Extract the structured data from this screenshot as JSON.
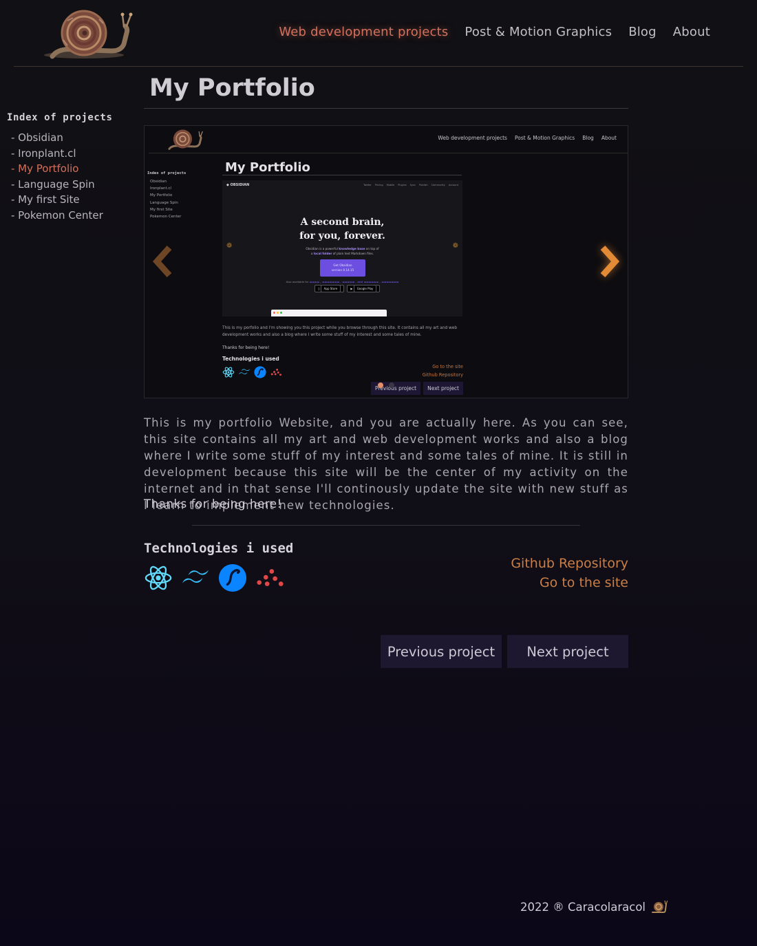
{
  "header": {
    "logo_icon": "snail-logo-icon",
    "nav": [
      {
        "label": "Web development projects",
        "active": true
      },
      {
        "label": "Post & Motion Graphics",
        "active": false
      },
      {
        "label": "Blog",
        "active": false
      },
      {
        "label": "About",
        "active": false
      }
    ]
  },
  "sidebar": {
    "title": "Index of projects",
    "items": [
      {
        "label": "- Obsidian"
      },
      {
        "label": "- Ironplant.cl"
      },
      {
        "label": "- My Portfolio",
        "active": true
      },
      {
        "label": "- Language Spin"
      },
      {
        "label": "- My first Site"
      },
      {
        "label": "- Pokemon Center"
      }
    ]
  },
  "main": {
    "title": "My Portfolio",
    "carousel": {
      "prev_icon": "chevron-left-icon",
      "next_icon": "chevron-right-icon",
      "slide_count": 2,
      "active_slide": 1,
      "preview": {
        "nav": [
          "Web development projects",
          "Post & Motion Graphics",
          "Blog",
          "About"
        ],
        "title": "My Portfolio",
        "sidebar_title": "Index of projects",
        "sidebar_items": [
          "Obsidian",
          "Ironplant.cl",
          "My Portfolio",
          "Language Spin",
          "My first Site",
          "Pokemon Center"
        ],
        "obsidian": {
          "brand": "OBSIDIAN",
          "links": [
            "Twitter",
            "Pricing",
            "Mobile",
            "Plugins",
            "Sync",
            "Publish",
            "Community",
            "Account"
          ],
          "headline_1": "A second brain,",
          "headline_2": "for you, forever.",
          "sub_1_pre": "Obsidian is a powerful ",
          "sub_1_bold": "knowledge base",
          "sub_1_post": " on top of",
          "sub_2_pre": "a ",
          "sub_2_bold": "local folder",
          "sub_2_post": " of plain text Markdown files.",
          "button_1": "Get Obsidian",
          "button_2": "version 0.14.15",
          "available": "Also available for",
          "app_store": "App Store",
          "google_play": "Google Play"
        },
        "paragraph": "This is my porfolio and I'm showing you this project while you browse through this site. It contains all my art and web development works and also a blog where I write some stuff of my interest and some tales of mine.",
        "thanks": "Thanks for being here!",
        "tech_title": "Technologies i used",
        "link_site": "Go to the site",
        "link_repo": "Github Repository",
        "prev": "Previous project",
        "next": "Next project"
      }
    },
    "description": "This is my portfolio Website, and you are actually here. As you can see, this site contains all my art and web development works and also a blog where I write some stuff of my interest and some tales of mine. It is still in development because this site will be the center of my activity on the internet and in that sense I'll continously update the site with new stuff as I learn to implement new technologies.",
    "thanks": "Thanks for being here!",
    "tech_title": "Technologies i used",
    "technologies": [
      "react-icon",
      "tailwind-icon",
      "swc-icon",
      "dots-logo-icon"
    ],
    "links": {
      "repo": "Github Repository",
      "site": "Go to the site"
    },
    "buttons": {
      "prev": "Previous project",
      "next": "Next project"
    }
  },
  "footer": {
    "text": "2022 ® Caracolaracol",
    "icon": "snail-icon"
  },
  "colors": {
    "accent": "#d4705c",
    "link": "#c97f47",
    "button_bg": "#1d1830",
    "background": "#111014"
  }
}
